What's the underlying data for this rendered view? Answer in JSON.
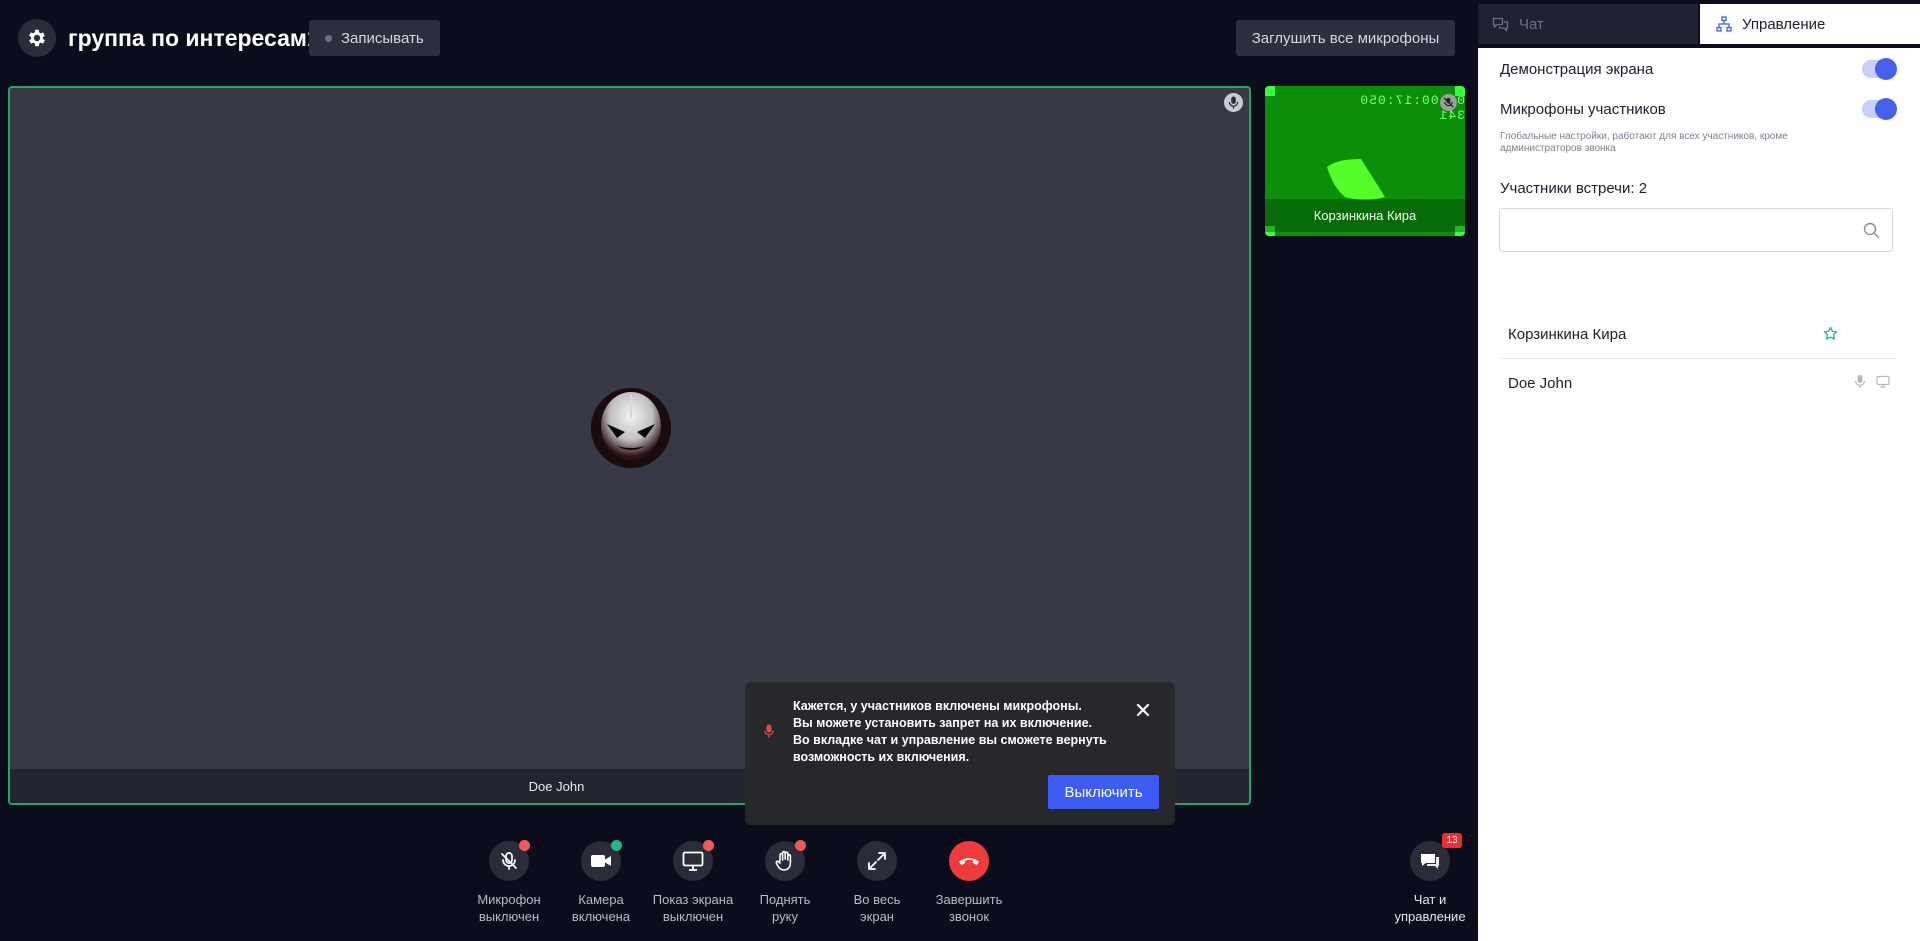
{
  "header": {
    "room_title": "группа по интересам1",
    "record_label": "Записывать",
    "mute_all_label": "Заглушить все микрофоны"
  },
  "main_tile": {
    "name": "Doe John"
  },
  "small_tile": {
    "name": "Корзинкина Кира",
    "timestamp": "00:00:17:050 341"
  },
  "toast": {
    "line1": "Кажется, у участников включены микрофоны.",
    "line2": "Вы можете установить запрет на их включение.",
    "line3": "Во вкладке чат и управление вы сможете вернуть",
    "line4": "возможность их включения.",
    "action_label": "Выключить"
  },
  "controls": {
    "mic": {
      "line1": "Микрофон",
      "line2": "выключен"
    },
    "camera": {
      "line1": "Камера",
      "line2": "включена"
    },
    "screen": {
      "line1": "Показ экрана",
      "line2": "выключен"
    },
    "hand": {
      "line1": "Поднять",
      "line2": "руку"
    },
    "fullscreen": {
      "line1": "Во весь",
      "line2": "экран"
    },
    "end": {
      "line1": "Завершить",
      "line2": "звонок"
    },
    "chat": {
      "line1": "Чат и",
      "line2": "управление",
      "badge": "13"
    }
  },
  "panel": {
    "tabs": {
      "chat": "Чат",
      "manage": "Управление"
    },
    "screen_demo_label": "Демонстрация экрана",
    "mics_label": "Микрофоны участников",
    "hint": "Глобальные настройки, работают для всех участников, кроме администраторов звонка",
    "participants_title": "Участники встречи: 2",
    "search_placeholder": "",
    "participants": [
      {
        "name": "Корзинкина Кира"
      },
      {
        "name": "Doe John"
      }
    ]
  },
  "colors": {
    "accent": "#3d5cf5",
    "speaking_border": "#22a463",
    "end_call": "#ee3b3b",
    "status_off": "#ee5a5a",
    "status_on": "#1fb88a"
  }
}
